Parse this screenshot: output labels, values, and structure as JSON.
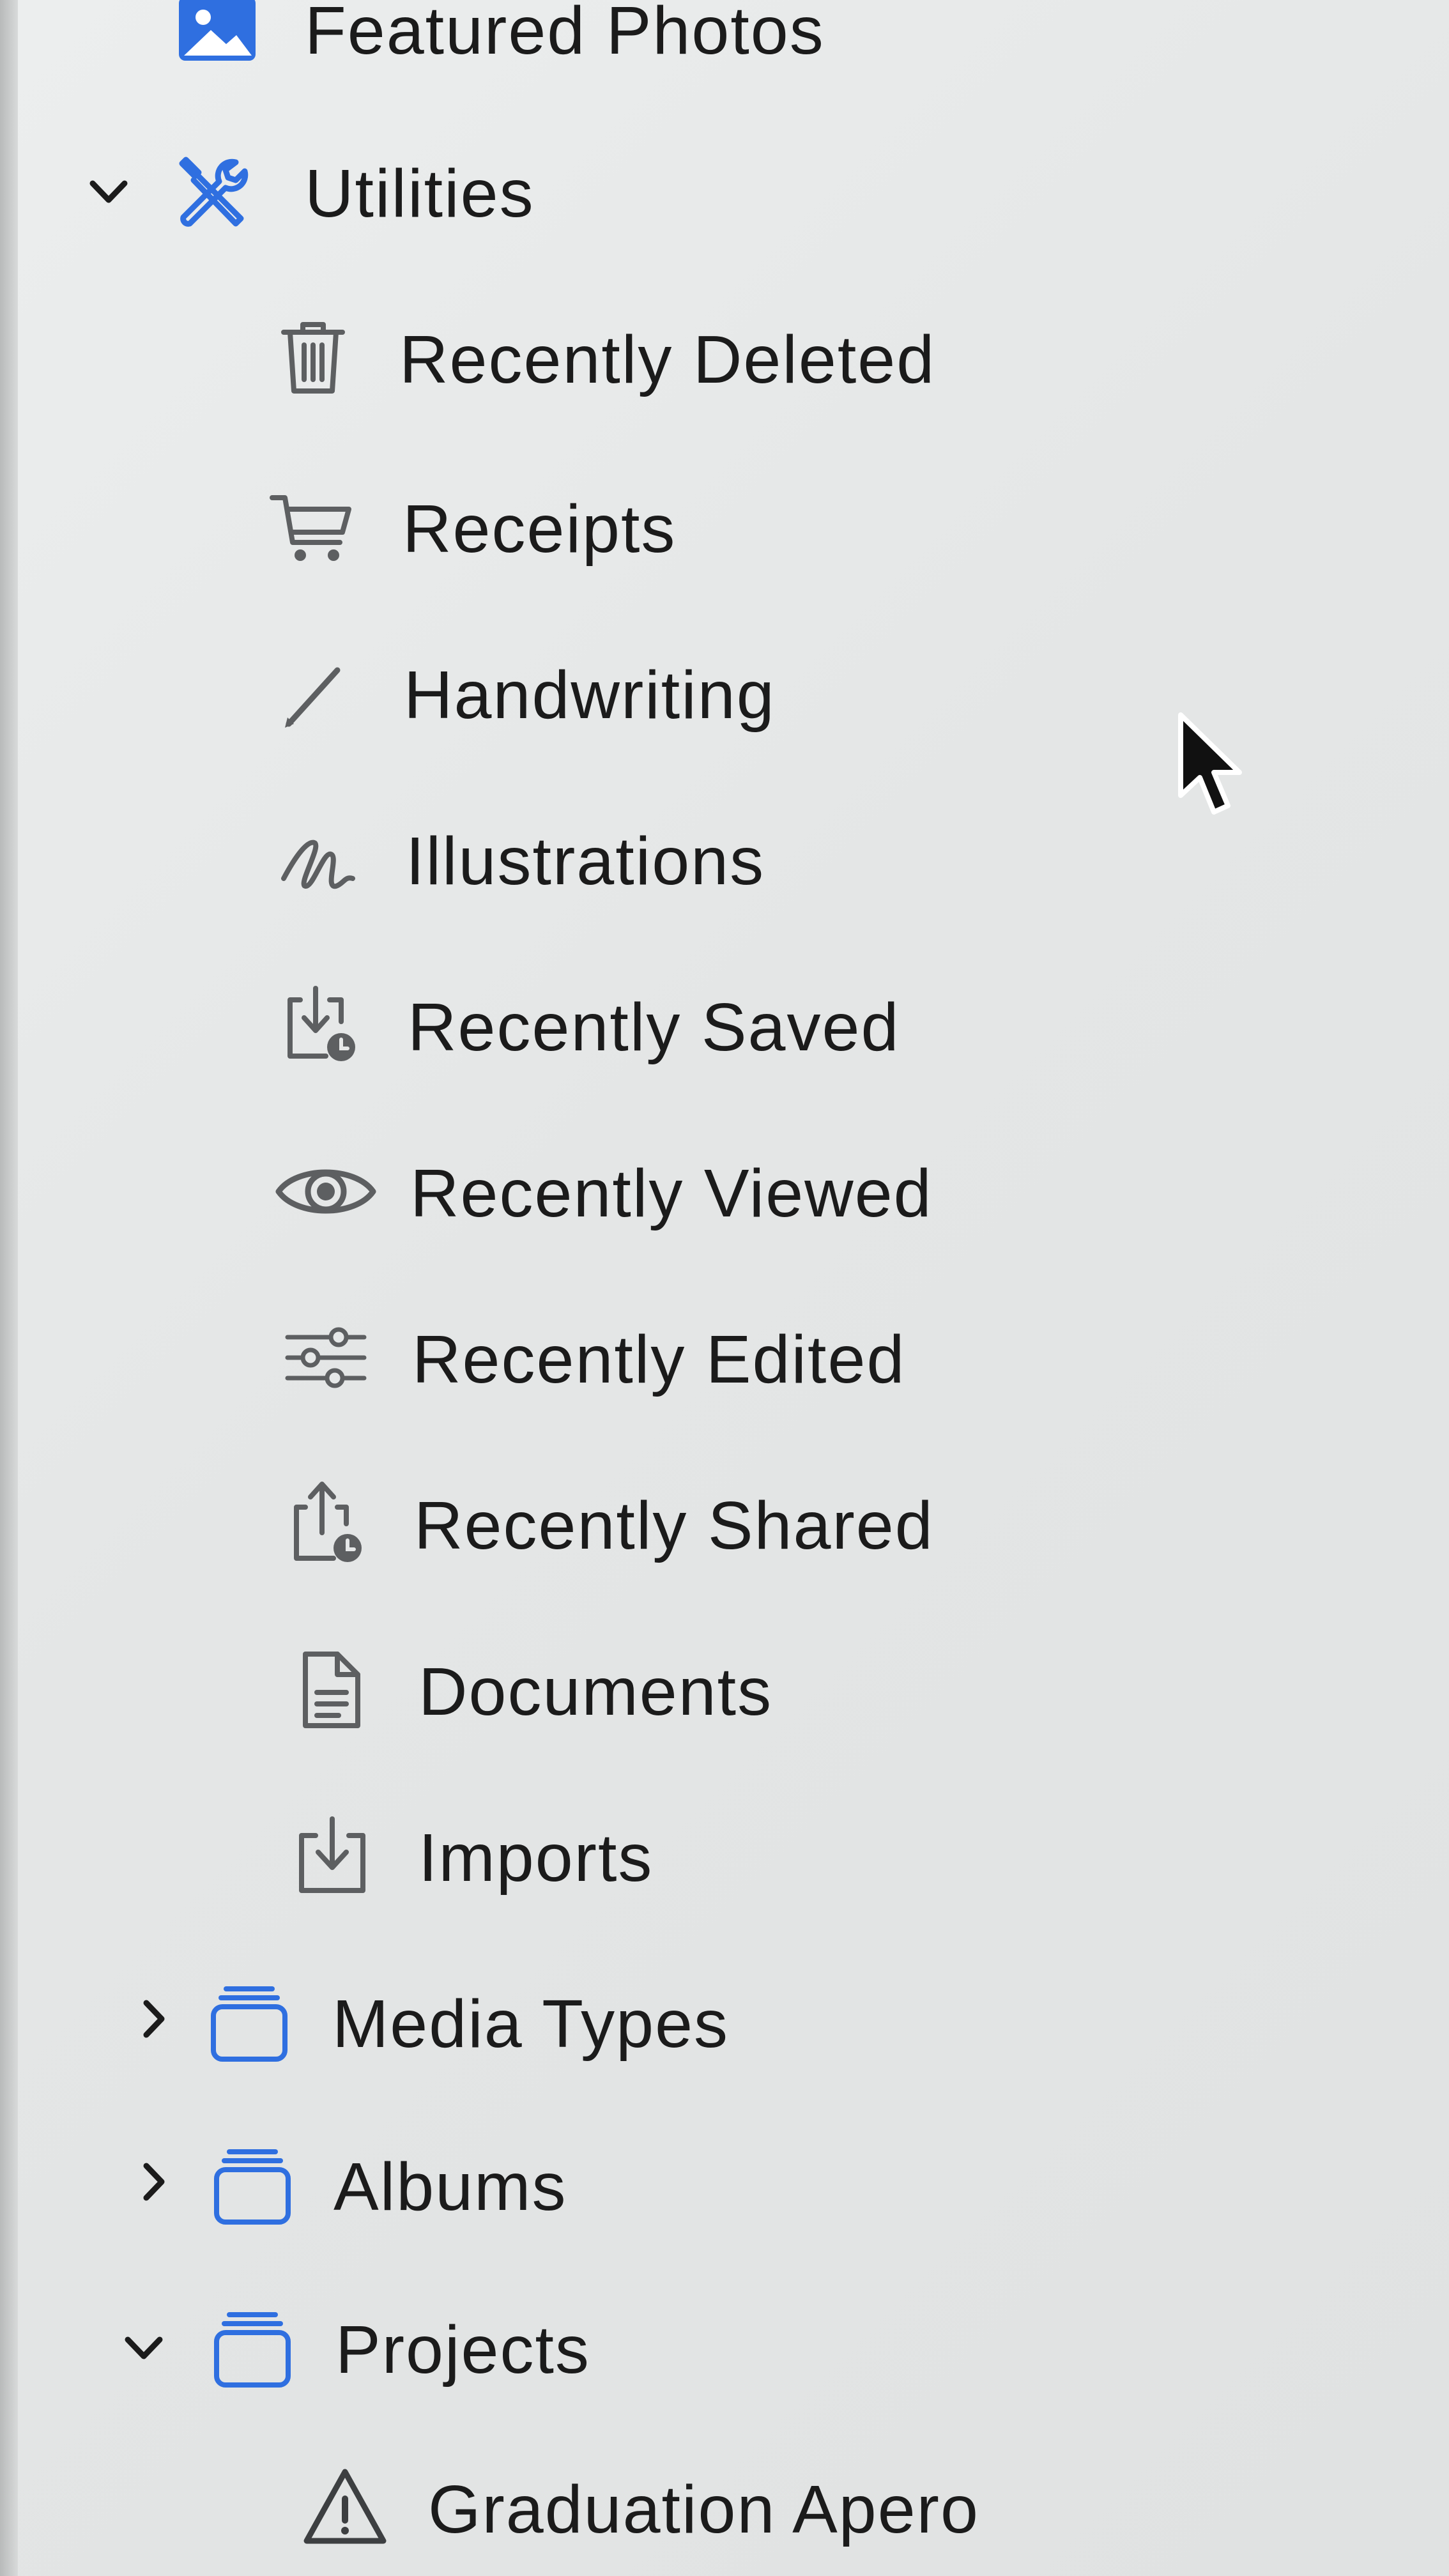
{
  "sidebar": {
    "items": [
      {
        "label": "Featured Photos",
        "icon": "featured-photos-icon",
        "color": "#2f6fe0"
      },
      {
        "label": "Utilities",
        "icon": "utilities-icon",
        "expanded": true,
        "color": "#2f6fe0"
      },
      {
        "label": "Recently Deleted",
        "icon": "trash-icon"
      },
      {
        "label": "Receipts",
        "icon": "cart-icon"
      },
      {
        "label": "Handwriting",
        "icon": "pencil-icon"
      },
      {
        "label": "Illustrations",
        "icon": "scribble-icon"
      },
      {
        "label": "Recently Saved",
        "icon": "recently-saved-icon"
      },
      {
        "label": "Recently Viewed",
        "icon": "eye-icon"
      },
      {
        "label": "Recently Edited",
        "icon": "sliders-icon"
      },
      {
        "label": "Recently Shared",
        "icon": "recently-shared-icon"
      },
      {
        "label": "Documents",
        "icon": "document-icon"
      },
      {
        "label": "Imports",
        "icon": "import-icon"
      },
      {
        "label": "Media Types",
        "icon": "stack-folder-icon",
        "expanded": false,
        "color": "#2f6fe0"
      },
      {
        "label": "Albums",
        "icon": "stack-folder-icon",
        "expanded": false,
        "color": "#2f6fe0"
      },
      {
        "label": "Projects",
        "icon": "stack-folder-icon",
        "expanded": true,
        "color": "#2f6fe0"
      },
      {
        "label": "Graduation Apero",
        "icon": "warning-triangle-icon"
      }
    ]
  },
  "colors": {
    "accent": "#2f6fe0",
    "text": "#1b1b1b",
    "icon_gray": "#5d5f61",
    "background": "#e6e8e8"
  }
}
